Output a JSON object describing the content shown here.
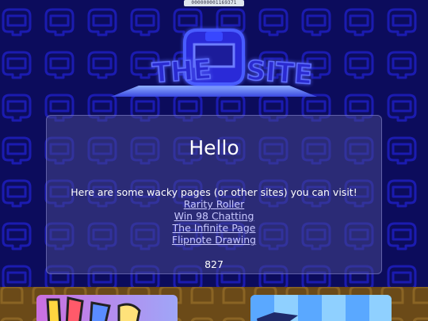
{
  "counter": {
    "value": "000000001169371"
  },
  "logo": {
    "text_left": "THE",
    "text_right": "SITE",
    "glow_color": "#3b3bff"
  },
  "main": {
    "title": "Hello",
    "intro": "Here are some wacky pages (or other sites) you can visit!",
    "links": [
      {
        "label": "Rarity Roller"
      },
      {
        "label": "Win 98 Chatting"
      },
      {
        "label": "The Infinite Page"
      },
      {
        "label": "Flipnote Drawing"
      }
    ],
    "count": "827"
  },
  "colors": {
    "background": "#0c0c5c",
    "pattern": "#1a1aa8",
    "card": "#46468c",
    "link": "#c9c9ff",
    "strip": "#6b4a18"
  }
}
